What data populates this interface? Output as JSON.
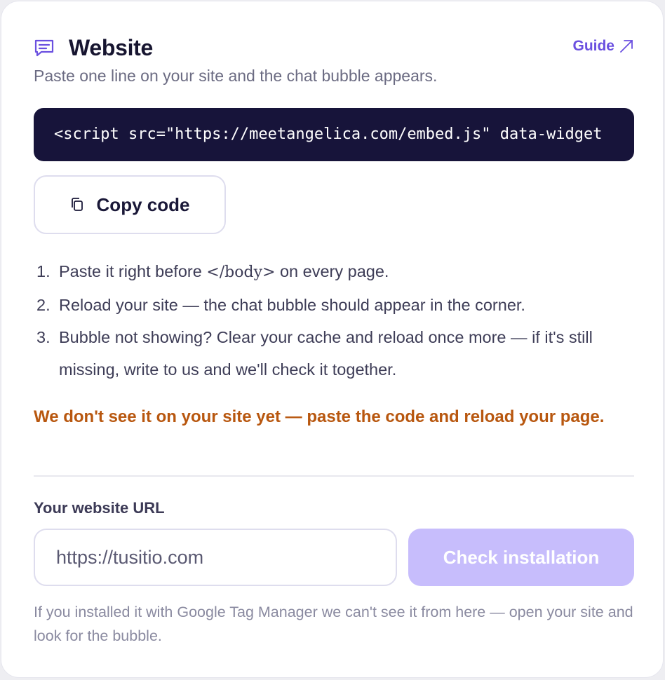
{
  "header": {
    "title": "Website",
    "guide_label": "Guide",
    "subtitle": "Paste one line on your site and the chat bubble appears."
  },
  "code_snippet": "<script src=\"https://meetangelica.com/embed.js\" data-widget",
  "copy_button": {
    "label": "Copy code"
  },
  "steps": [
    {
      "num": "1.",
      "before": "Paste it right before ",
      "tag": "</body>",
      "after": " on every page."
    },
    {
      "num": "2.",
      "text": "Reload your site — the chat bubble should appear in the corner."
    },
    {
      "num": "3.",
      "text": "Bubble not showing? Clear your cache and reload once more — if it's still missing, write to us and we'll check it together."
    }
  ],
  "warning": "We don't see it on your site yet — paste the code and reload your page.",
  "url_section": {
    "label": "Your website URL",
    "placeholder": "https://tusitio.com",
    "value": "",
    "check_button": "Check installation"
  },
  "footnote": "If you installed it with Google Tag Manager we can't see it from here — open your site and look for the bubble.",
  "colors": {
    "accent": "#6a4fe0",
    "code_bg": "#17143a",
    "warning": "#b8570f",
    "button_disabled": "#c7bdfc"
  },
  "icons": {
    "title": "chat-icon",
    "guide": "arrow-up-right-icon",
    "copy": "copy-icon"
  }
}
